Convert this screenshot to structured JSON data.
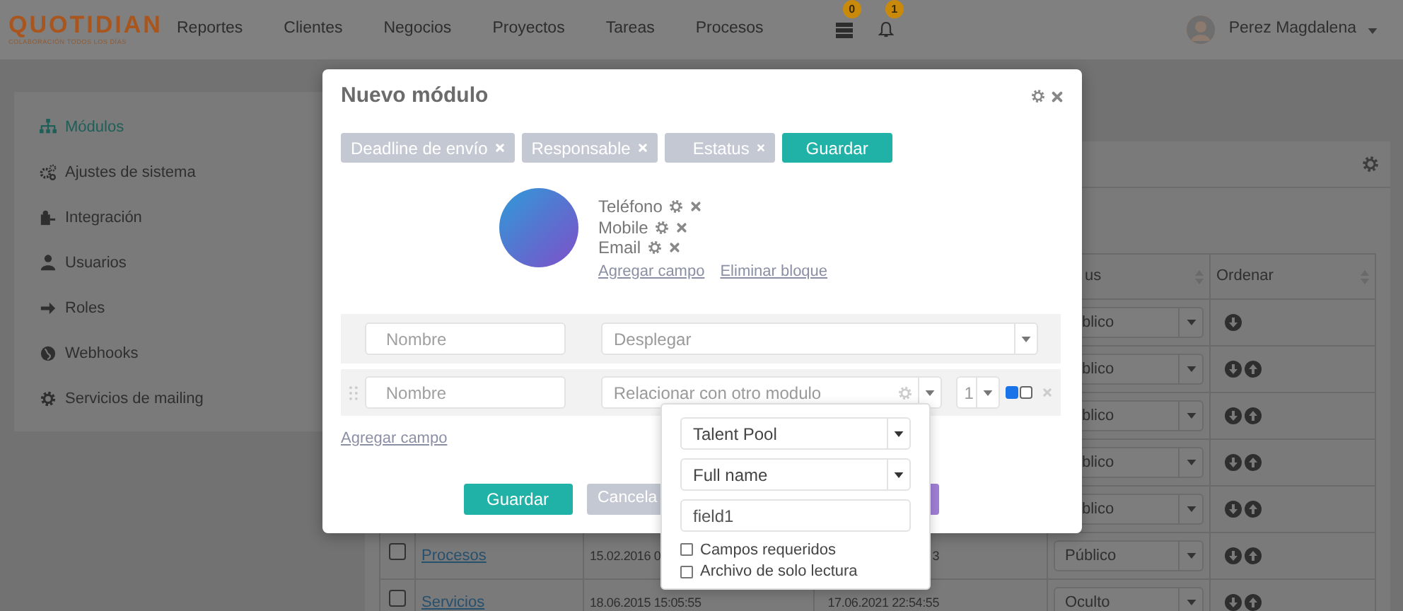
{
  "navbar": {
    "logo": "QUOTIDIAN",
    "tagline": "COLABORACIÓN TODOS LOS DÍAS",
    "links": [
      "Reportes",
      "Clientes",
      "Negocios",
      "Proyectos",
      "Tareas",
      "Procesos"
    ],
    "notifications": [
      "0",
      "1"
    ],
    "user": "Perez Magdalena"
  },
  "sidebar": {
    "items": [
      {
        "label": "Módulos",
        "selected": true
      },
      {
        "label": "Ajustes de sistema",
        "selected": false
      },
      {
        "label": "Integración",
        "selected": false
      },
      {
        "label": "Usuarios",
        "selected": false
      },
      {
        "label": "Roles",
        "selected": false
      },
      {
        "label": "Webhooks",
        "selected": false
      },
      {
        "label": "Servicios de mailing",
        "selected": false
      }
    ]
  },
  "table": {
    "header": {
      "status": "us",
      "order": "Ordenar"
    },
    "rows": [
      {
        "status": "blico",
        "status_partial": true,
        "moves": [
          {
            "kind": "down"
          }
        ]
      },
      {
        "status": "blico",
        "status_partial": true,
        "moves": [
          {
            "kind": "down"
          },
          {
            "kind": "up"
          }
        ]
      },
      {
        "status": "blico",
        "status_partial": true,
        "moves": [
          {
            "kind": "down"
          },
          {
            "kind": "up"
          }
        ]
      },
      {
        "status": "blico",
        "status_partial": true,
        "moves": [
          {
            "kind": "down"
          },
          {
            "kind": "up"
          }
        ]
      },
      {
        "status": "blico",
        "status_partial": true,
        "moves": [
          {
            "kind": "down"
          },
          {
            "kind": "up"
          }
        ]
      },
      {
        "checked": false,
        "name": "Procesos",
        "created": "15.02.2016 0",
        "modified": "3",
        "status": "Público",
        "status_partial": false,
        "moves": [
          {
            "kind": "down"
          },
          {
            "kind": "up"
          }
        ]
      },
      {
        "checked": false,
        "name": "Servicios",
        "created": "18.06.2015 15:05:55",
        "modified": "17.06.2021 22:54:55",
        "status": "Oculto",
        "status_partial": false,
        "moves": [
          {
            "kind": "down"
          },
          {
            "kind": "up"
          }
        ]
      }
    ]
  },
  "modal": {
    "title": "Nuevo módulo",
    "chips": [
      "Deadline de envío",
      "Responsable",
      "Estatus"
    ],
    "save": "Guardar",
    "contact": {
      "fields": [
        "Teléfono",
        "Mobile",
        "Email"
      ],
      "links": [
        "Agregar campo",
        "Eliminar bloque"
      ]
    },
    "field_rows": [
      {
        "kind": "dropdown",
        "placeholder": "Nombre",
        "type": "Desplegar"
      },
      {
        "kind": "relation",
        "placeholder": "Nombre",
        "type": "Relacionar con otro modulo",
        "count": "1",
        "checks": [
          true,
          false
        ]
      }
    ],
    "add_field": "Agregar campo",
    "footer": [
      {
        "kind": "primary",
        "label": "Guardar"
      },
      {
        "kind": "secondary",
        "label": "Cancela"
      },
      {
        "kind": "accent"
      }
    ]
  },
  "popover": {
    "module": "Talent Pool",
    "field": "Full name",
    "key_value": "field1",
    "options": [
      {
        "label": "Campos requeridos",
        "checked": false
      },
      {
        "label": "Archivo de solo lectura",
        "checked": false
      }
    ]
  }
}
